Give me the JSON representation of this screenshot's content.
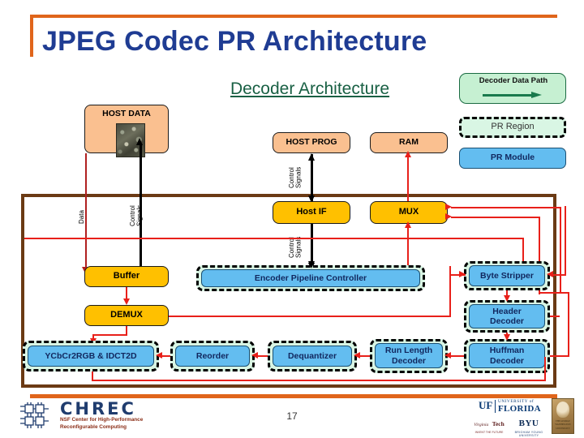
{
  "slide": {
    "title": "JPEG Codec PR Architecture",
    "subtitle": "Decoder Architecture",
    "page_number": "17"
  },
  "legend": {
    "decoder_data_path": "Decoder Data Path",
    "pr_region": "PR Region",
    "pr_module": "PR Module"
  },
  "colors": {
    "title_blue": "#1F3C93",
    "accent_orange": "#E0651B",
    "subtitle_green": "#196044",
    "frame_brown": "#6B3A14",
    "host_box_peach": "#FAC090",
    "logic_box_yellow": "#FFC000",
    "pr_module_blue": "#63BDF0",
    "pr_region_fill": "#D9F6E4",
    "data_path_red": "#E8201A",
    "control_black": "#000000"
  },
  "nodes": {
    "host_data": "HOST DATA",
    "host_prog": "HOST PROG",
    "ram": "RAM",
    "host_if": "Host IF",
    "mux": "MUX",
    "buffer": "Buffer",
    "demux": "DEMUX",
    "encoder_pipeline_controller": "Encoder Pipeline Controller",
    "ycbcr2rgb_idct2d": "YCbCr2RGB & IDCT2D",
    "reorder": "Reorder",
    "dequantizer": "Dequantizer",
    "run_length_decoder": "Run Length\nDecoder",
    "byte_stripper": "Byte Stripper",
    "header_decoder": "Header\nDecoder",
    "huffman_decoder": "Huffman\nDecoder"
  },
  "edge_labels": {
    "data": "Data",
    "control_signals_left": "Control\nSignals",
    "control_signals_hostprog": "Control\nSignals",
    "control_signals_hostif": "Control\nSignals"
  },
  "footer": {
    "chrec_name": "CHREC",
    "chrec_tagline_line1": "NSF Center for High-Performance",
    "chrec_tagline_line2": "Reconfigurable Computing",
    "uf_mark": "UF",
    "uf_university": "UNIVERSITY of",
    "uf_florida": "FLORIDA",
    "vt_top": "Virginia",
    "vt_bottom": "Tech",
    "vt_sub": "INVENT THE FUTURE",
    "byu": "BYU",
    "byu_sub": "BRIGHAM YOUNG UNIVERSITY",
    "gw_line1": "THE GEORGE",
    "gw_line2": "WASHINGTON",
    "gw_line3": "UNIVERSITY"
  }
}
